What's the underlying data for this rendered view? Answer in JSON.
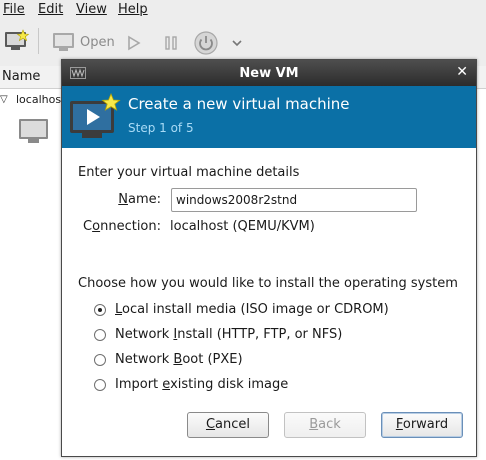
{
  "menubar": {
    "items": [
      "File",
      "Edit",
      "View",
      "Help"
    ]
  },
  "toolbar": {
    "open_label": "Open"
  },
  "vm_list": {
    "column_header": "Name",
    "host_label": "localhost"
  },
  "dialog": {
    "title": "New VM",
    "banner_title": "Create a new virtual machine",
    "step": "Step 1 of 5",
    "details_heading": "Enter your virtual machine details",
    "name_label": "Name:",
    "name_value": "windows2008r2stnd",
    "connection_label": "Connection:",
    "connection_value": "localhost (QEMU/KVM)",
    "install_heading": "Choose how you would like to install the operating system",
    "install_options": [
      {
        "label": "Local install media (ISO image or CDROM)",
        "selected": true
      },
      {
        "label": "Network Install (HTTP, FTP, or NFS)",
        "selected": false
      },
      {
        "label": "Network Boot (PXE)",
        "selected": false
      },
      {
        "label": "Import existing disk image",
        "selected": false
      }
    ],
    "buttons": {
      "cancel": "Cancel",
      "back": "Back",
      "forward": "Forward"
    }
  },
  "colors": {
    "banner": "#0b70a6",
    "banner_step": "#a9dbf6",
    "titlebar": "#333333"
  },
  "icons": [
    "new-vm-icon",
    "monitor-icon",
    "play-icon",
    "pause-icon",
    "power-icon",
    "chevron-down-icon",
    "close-icon",
    "vm-logo-icon"
  ]
}
